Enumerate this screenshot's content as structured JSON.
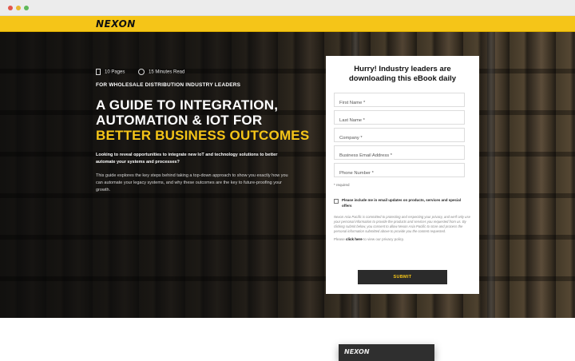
{
  "header": {
    "logo": "NEXON"
  },
  "hero": {
    "pages": "10 Pages",
    "read_time": "15 Minutes Read",
    "kicker": "FOR WHOLESALE DISTRIBUTION INDUSTRY LEADERS",
    "headline_line1": "A GUIDE TO INTEGRATION,",
    "headline_line2": "AUTOMATION & IOT FOR",
    "headline_highlight": "BETTER BUSINESS OUTCOMES",
    "lead": "Looking to reveal opportunities to integrate new IoT and technology solutions to better automate your systems and processes?",
    "body": "This guide explores the key steps behind taking a top-down approach to show you exactly how you can automate your legacy systems, and why these outcomes are the key to future-proofing your growth."
  },
  "form": {
    "title": "Hurry! Industry leaders are downloading this eBook daily",
    "fields": {
      "first_name": "First Name *",
      "last_name": "Last Name *",
      "company": "Company *",
      "email": "Business Email Address *",
      "phone": "Phone Number *"
    },
    "required_note": "* required",
    "consent": "Please include me in email updates on products, services and special offers",
    "privacy": "Nexon Asia Pacific is committed to protecting and respecting your privacy, and we'll only use your personal information to provide the products and services you requested from us. By clicking submit below, you consent to allow Nexon Asia Pacific to store and process the personal information submitted above to provide you the content requested.",
    "privacy_prefix": "Please",
    "privacy_link": "click here",
    "privacy_suffix": "to view our privacy policy.",
    "submit": "SUBMIT"
  },
  "below": {
    "ebook_logo": "NEXON"
  },
  "colors": {
    "accent": "#f5c518",
    "dark": "#2b2b2b"
  }
}
